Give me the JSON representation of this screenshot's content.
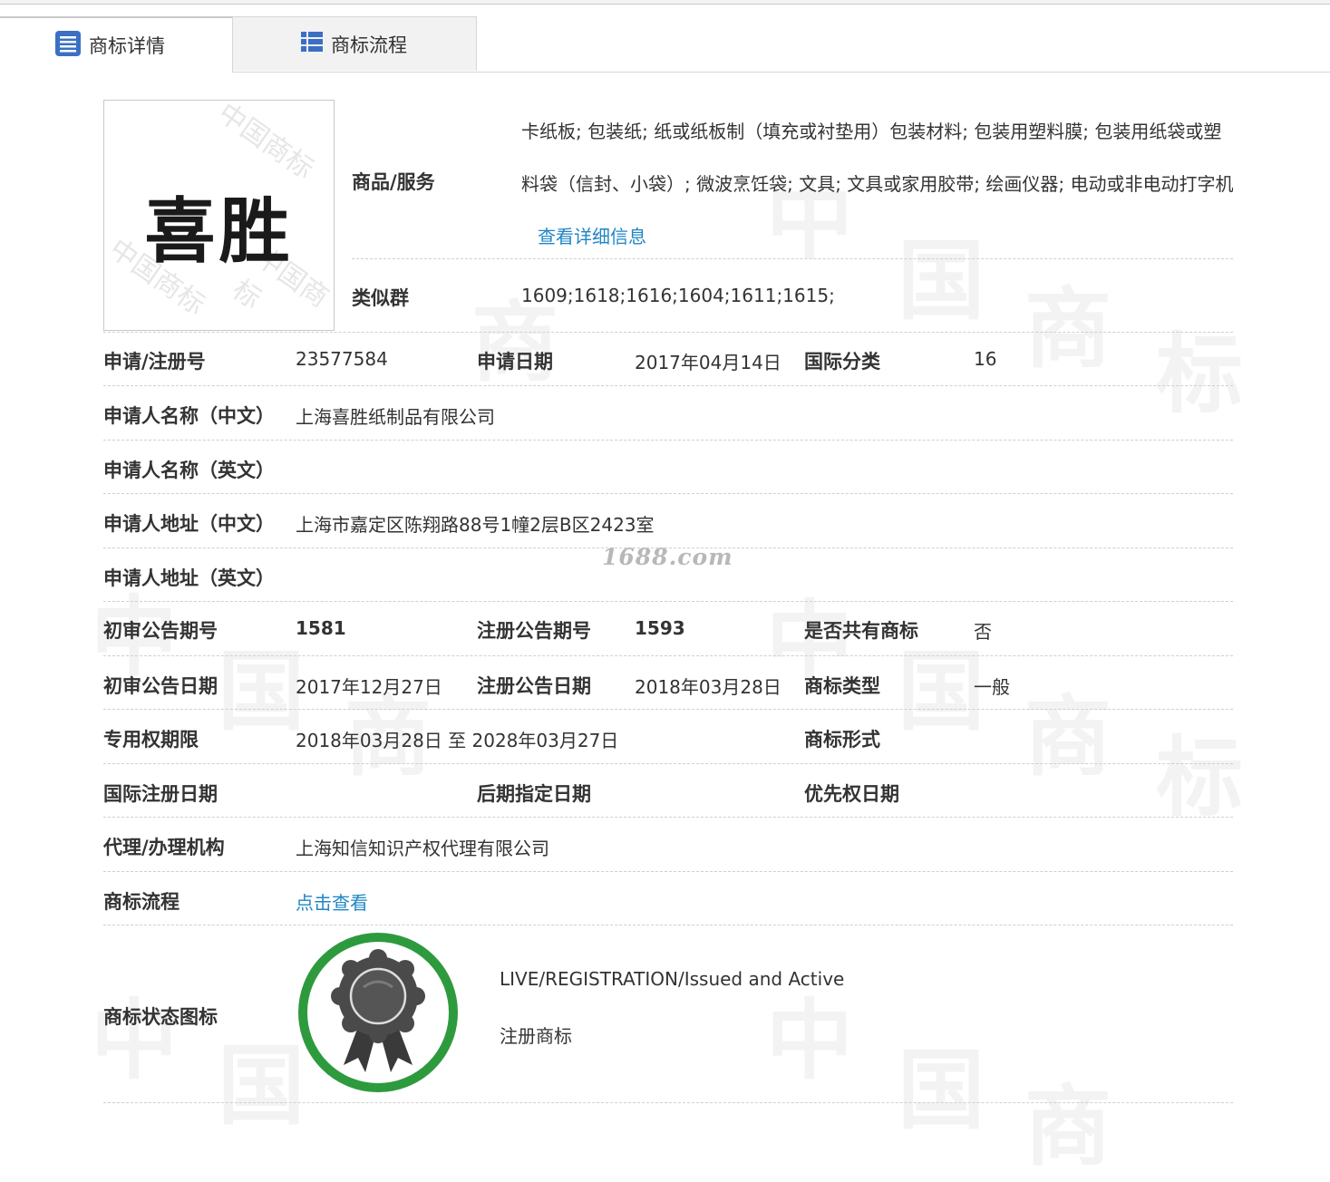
{
  "tabs": [
    {
      "label": "商标详情",
      "icon": "document-list-icon",
      "active": true
    },
    {
      "label": "商标流程",
      "icon": "list-grid-icon",
      "active": false
    }
  ],
  "logo": {
    "text": "喜胜",
    "watermark": "中国商标"
  },
  "goods": {
    "label": "商品/服务",
    "text": "卡纸板; 包装纸; 纸或纸板制（填充或衬垫用）包装材料; 包装用塑料膜; 包装用纸袋或塑料袋（信封、小袋）; 微波烹饪袋; 文具; 文具或家用胶带; 绘画仪器; 电动或非电动打字机",
    "more_link": "查看详细信息"
  },
  "similar_group": {
    "label": "类似群",
    "value": "1609;1618;1616;1604;1611;1615;"
  },
  "fields": {
    "reg_no": {
      "label": "申请/注册号",
      "value": "23577584"
    },
    "apply_date": {
      "label": "申请日期",
      "value": "2017年04月14日"
    },
    "intl_class": {
      "label": "国际分类",
      "value": "16"
    },
    "applicant_cn": {
      "label": "申请人名称（中文）",
      "value": "上海喜胜纸制品有限公司"
    },
    "applicant_en": {
      "label": "申请人名称（英文）",
      "value": ""
    },
    "address_cn": {
      "label": "申请人地址（中文）",
      "value": "上海市嘉定区陈翔路88号1幢2层B区2423室"
    },
    "address_en": {
      "label": "申请人地址（英文）",
      "value": ""
    },
    "prelim_issue": {
      "label": "初审公告期号",
      "value": "1581"
    },
    "reg_issue": {
      "label": "注册公告期号",
      "value": "1593"
    },
    "shared": {
      "label": "是否共有商标",
      "value": "否"
    },
    "prelim_date": {
      "label": "初审公告日期",
      "value": "2017年12月27日"
    },
    "reg_date": {
      "label": "注册公告日期",
      "value": "2018年03月28日"
    },
    "tm_type": {
      "label": "商标类型",
      "value": "一般"
    },
    "exclusive_period": {
      "label": "专用权期限",
      "value": "2018年03月28日 至 2028年03月27日"
    },
    "tm_form": {
      "label": "商标形式",
      "value": ""
    },
    "intl_reg_date": {
      "label": "国际注册日期",
      "value": ""
    },
    "later_date": {
      "label": "后期指定日期",
      "value": ""
    },
    "priority_date": {
      "label": "优先权日期",
      "value": ""
    },
    "agency": {
      "label": "代理/办理机构",
      "value": "上海知信知识产权代理有限公司"
    },
    "process": {
      "label": "商标流程",
      "value": "点击查看"
    }
  },
  "status": {
    "label": "商标状态图标",
    "icon": "award-ribbon-icon",
    "status_en": "LIVE/REGISTRATION/Issued and Active",
    "status_cn": "注册商标",
    "ring_color": "#2e9a3e"
  },
  "site_watermark": "1688.com",
  "page_watermark": [
    "中",
    "国",
    "商",
    "标"
  ]
}
